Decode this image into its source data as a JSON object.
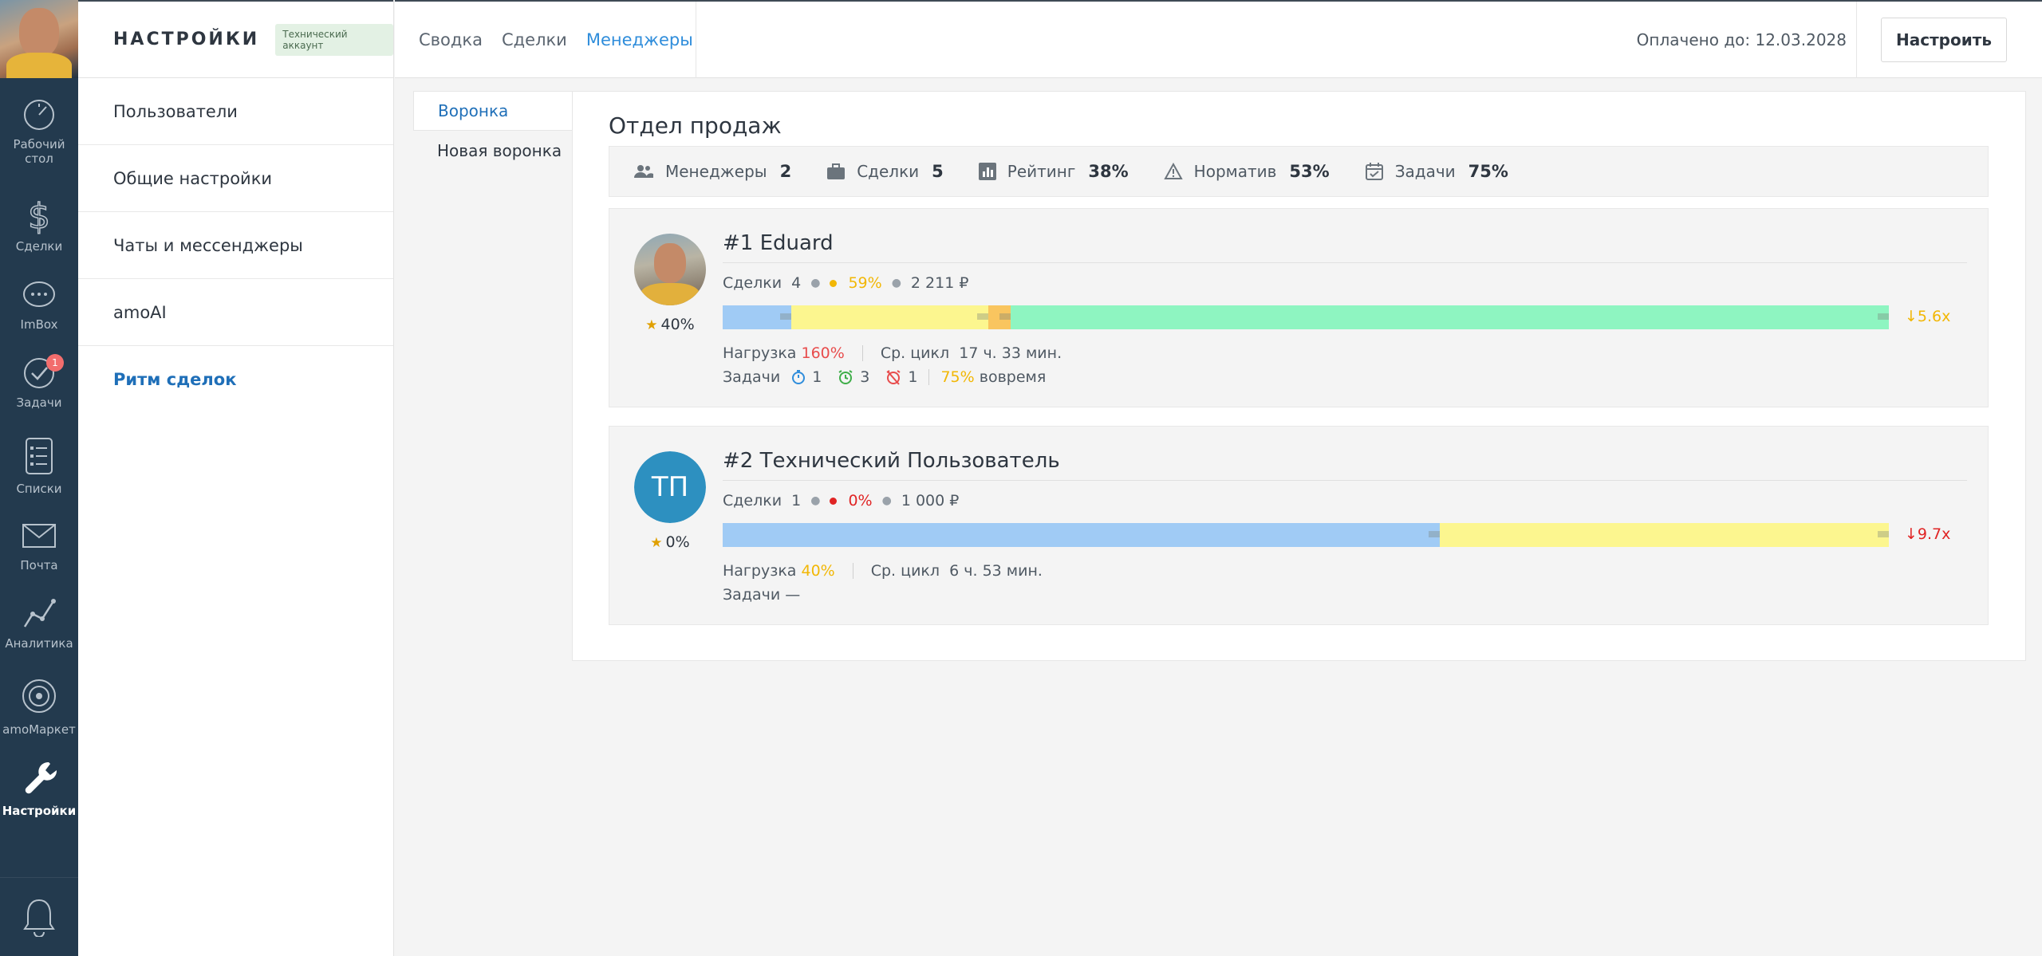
{
  "nav": {
    "items": [
      {
        "label": "Рабочий\nстол",
        "icon": "dashboard-icon"
      },
      {
        "label": "Сделки",
        "icon": "dollar-icon"
      },
      {
        "label": "ImBox",
        "icon": "chat-icon"
      },
      {
        "label": "Задачи",
        "icon": "check-icon",
        "badge": "1"
      },
      {
        "label": "Списки",
        "icon": "list-icon"
      },
      {
        "label": "Почта",
        "icon": "mail-icon"
      },
      {
        "label": "Аналитика",
        "icon": "analytics-icon"
      },
      {
        "label": "amoМаркет",
        "icon": "market-icon"
      },
      {
        "label": "Настройки",
        "icon": "wrench-icon"
      }
    ]
  },
  "settings": {
    "title": "НАСТРОЙКИ",
    "badge": "Технический аккаунт",
    "items": [
      "Пользователи",
      "Общие настройки",
      "Чаты и мессенджеры",
      "amoAI",
      "Ритм сделок"
    ]
  },
  "header": {
    "tabs": [
      "Сводка",
      "Сделки",
      "Менеджеры"
    ],
    "paid": "Оплачено до: 12.03.2028",
    "setup_button": "Настроить"
  },
  "funnels": [
    "Воронка",
    "Новая воронка"
  ],
  "department": {
    "title": "Отдел продаж",
    "stats": [
      {
        "label": "Менеджеры",
        "value": "2",
        "icon": "users-icon"
      },
      {
        "label": "Сделки",
        "value": "5",
        "icon": "briefcase-icon"
      },
      {
        "label": "Рейтинг",
        "value": "38%",
        "icon": "bar-chart-icon"
      },
      {
        "label": "Норматив",
        "value": "53%",
        "icon": "warning-icon"
      },
      {
        "label": "Задачи",
        "value": "75%",
        "icon": "calendar-check-icon"
      }
    ]
  },
  "managers": [
    {
      "title": "#1 Eduard",
      "rating": "40%",
      "deals_label": "Сделки",
      "deals_count": "4",
      "percent": "59%",
      "percent_color": "#f2b705",
      "amount": "2 211 ₽",
      "bar": [
        {
          "fraction": 0.059,
          "color": "#a0cbf5"
        },
        {
          "fraction": 0.169,
          "color": "#fcf68f"
        },
        {
          "fraction": 0.019,
          "color": "#f9c55f"
        },
        {
          "fraction": 0.753,
          "color": "#8ef5c1"
        }
      ],
      "multiplier": "↓5.6x",
      "multiplier_color": "#f2b705",
      "load_label": "Нагрузка",
      "load": "160%",
      "load_color": "#e84c4c",
      "cycle_label": "Ср. цикл",
      "cycle": "17 ч. 33 мин.",
      "tasks_label": "Задачи",
      "tasks": {
        "clock": "1",
        "alarm": "3",
        "overdue": "1",
        "ontime_pct": "75%",
        "ontime_label": "вовремя"
      }
    },
    {
      "title": "#2 Технический Пользователь",
      "initials": "ТП",
      "rating": "0%",
      "deals_label": "Сделки",
      "deals_count": "1",
      "percent": "0%",
      "percent_color": "#e02424",
      "amount": "1 000 ₽",
      "bar": [
        {
          "fraction": 0.615,
          "color": "#a0cbf5"
        },
        {
          "fraction": 0.385,
          "color": "#fcf68f"
        }
      ],
      "multiplier": "↓9.7x",
      "multiplier_color": "#e02424",
      "load_label": "Нагрузка",
      "load": "40%",
      "load_color": "#f2b705",
      "cycle_label": "Ср. цикл",
      "cycle": "6 ч. 53 мин.",
      "tasks_label": "Задачи",
      "tasks_empty": "—"
    }
  ]
}
